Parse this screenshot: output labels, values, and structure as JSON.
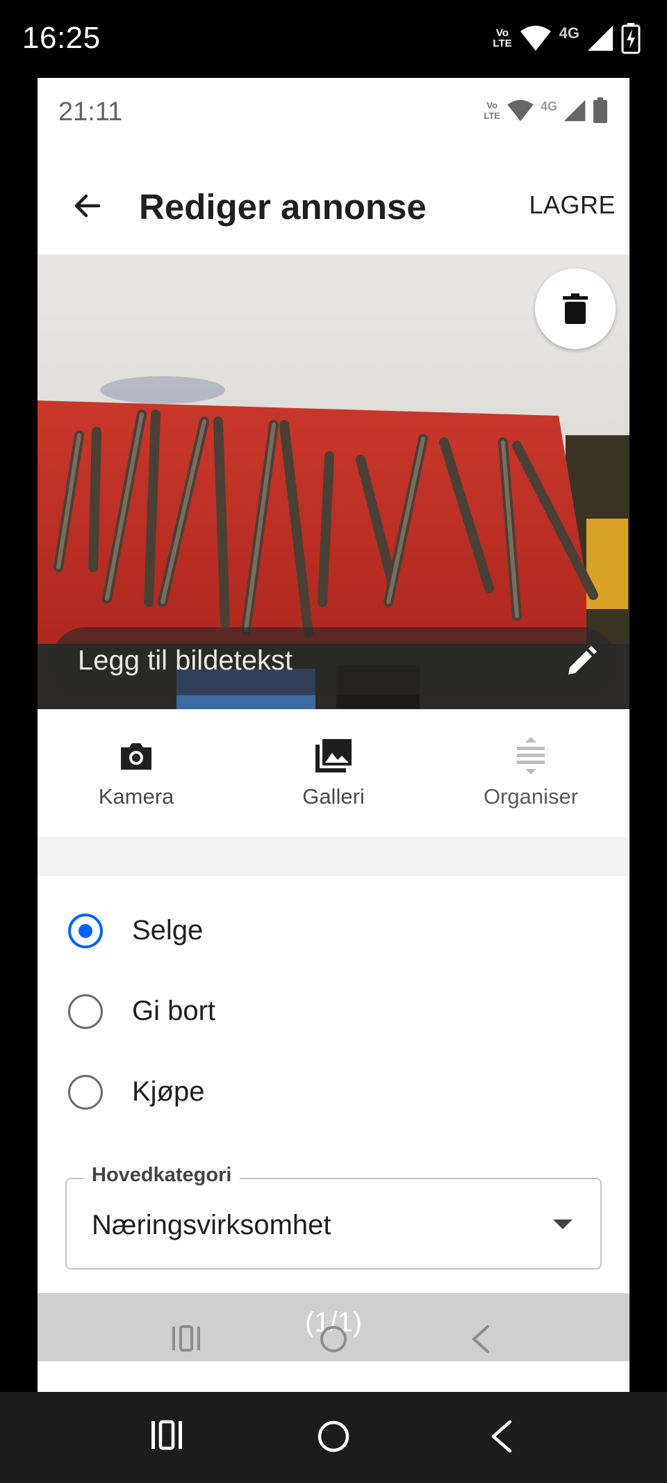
{
  "system_status": {
    "time": "16:25",
    "volte_top": "Vo",
    "volte_bottom": "LTE",
    "network": "4G"
  },
  "inner_status": {
    "time": "21:11",
    "volte_top": "Vo",
    "volte_bottom": "LTE",
    "network": "4G"
  },
  "appbar": {
    "title": "Rediger annonse",
    "save_label": "LAGRE"
  },
  "photo": {
    "caption_placeholder": "Legg til bildetekst"
  },
  "photo_actions": [
    {
      "label": "Kamera",
      "icon": "camera-icon"
    },
    {
      "label": "Galleri",
      "icon": "gallery-icon"
    },
    {
      "label": "Organiser",
      "icon": "reorder-icon"
    }
  ],
  "ad_type": {
    "options": [
      {
        "label": "Selge",
        "checked": true
      },
      {
        "label": "Gi bort",
        "checked": false
      },
      {
        "label": "Kjøpe",
        "checked": false
      }
    ]
  },
  "category": {
    "legend": "Hovedkategori",
    "value": "Næringsvirksomhet"
  },
  "inner_nav": {
    "page_counter": "(1/1)"
  },
  "colors": {
    "accent": "#0063fb",
    "text": "#1f1f1f"
  }
}
